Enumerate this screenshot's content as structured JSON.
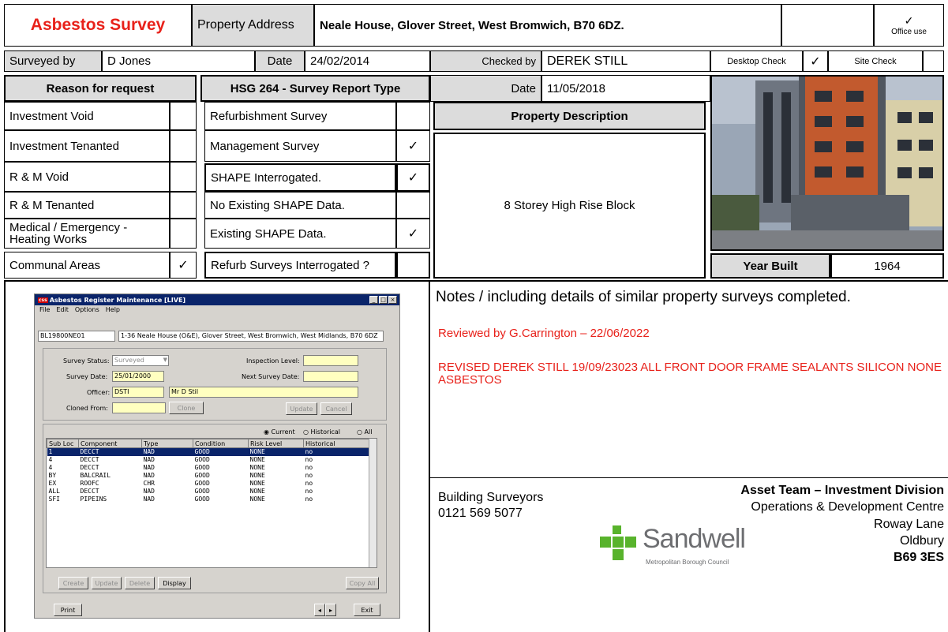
{
  "header": {
    "title": "Asbestos Survey",
    "address_label": "Property Address",
    "address_value": "Neale House, Glover Street, West Bromwich, B70 6DZ.",
    "office_tick": "✓",
    "office_label": "Office use"
  },
  "surveyed": {
    "label": "Surveyed by",
    "value": "D Jones",
    "date_label": "Date",
    "date_value": "24/02/2014"
  },
  "checked": {
    "label": "Checked by",
    "value": "DEREK STILL",
    "desktop_label": "Desktop Check",
    "desktop_tick": "✓",
    "site_label": "Site Check",
    "site_tick": "",
    "date_label": "Date",
    "date_value": "11/05/2018"
  },
  "reason": {
    "heading": "Reason for request",
    "items": [
      {
        "label": "Investment Void",
        "tick": ""
      },
      {
        "label": "Investment Tenanted",
        "tick": ""
      },
      {
        "label": "R & M Void",
        "tick": ""
      },
      {
        "label": "R & M Tenanted",
        "tick": ""
      },
      {
        "label": "Medical / Emergency - Heating Works",
        "tick": ""
      },
      {
        "label": "Communal Areas",
        "tick": "✓"
      }
    ]
  },
  "hsg": {
    "heading": "HSG 264 - Survey Report Type",
    "items": [
      {
        "label": "Refurbishment Survey",
        "tick": ""
      },
      {
        "label": "Management Survey",
        "tick": "✓"
      },
      {
        "label": "SHAPE Interrogated.",
        "tick": "✓"
      },
      {
        "label": "No Existing SHAPE Data.",
        "tick": ""
      },
      {
        "label": "Existing SHAPE Data.",
        "tick": "✓"
      },
      {
        "label": "Refurb Surveys Interrogated ?",
        "tick": ""
      }
    ]
  },
  "property": {
    "heading": "Property Description",
    "description": "8 Storey High Rise Block",
    "year_label": "Year Built",
    "year_value": "1964"
  },
  "notes": {
    "heading": "Notes / including details of similar property surveys completed.",
    "reviewed": "Reviewed by G.Carrington – 22/06/2022",
    "revised": "REVISED DEREK STILL 19/09/23023 ALL FRONT DOOR FRAME SEALANTS SILICON NONE ASBESTOS"
  },
  "contact": {
    "dept": "Building Surveyors",
    "phone": "0121 569 5077",
    "team": "Asset Team – Investment Division",
    "addr1": "Operations & Development Centre",
    "addr2": "Roway Lane",
    "addr3": "Oldbury",
    "postcode": "B69 3ES",
    "logo_name": "Sandwell",
    "logo_sub": "Metropolitan Borough Council",
    "logo_color": "#58b32c"
  },
  "window": {
    "title": "Asbestos Register Maintenance [LIVE]",
    "menu": [
      "File",
      "Edit",
      "Options",
      "Help"
    ],
    "code": "BL19800NE01",
    "address": "1-36 Neale House (O&E), Glover Street, West Bromwich, West Midlands, B70 6DZ",
    "status_label": "Survey Status:",
    "status_value": "Surveyed",
    "date_label": "Survey Date:",
    "date_value": "25/01/2000",
    "officer_label": "Officer:",
    "officer_code": "DSTI",
    "officer_name": "Mr D Stil",
    "cloned_label": "Cloned From:",
    "cloned_value": "",
    "clone_btn": "Clone",
    "insp_label": "Inspection Level:",
    "insp_value": "",
    "next_label": "Next Survey Date:",
    "next_value": "",
    "update_btn": "Update",
    "cancel_btn": "Cancel",
    "radio_current": "Current",
    "radio_historical": "Historical",
    "radio_all": "All",
    "columns": [
      "Sub Loc",
      "Component",
      "Type",
      "Condition",
      "Risk Level",
      "Historical"
    ],
    "rows": [
      [
        "1",
        "DECCT",
        "NAD",
        "GOOD",
        "NONE",
        "no"
      ],
      [
        "4",
        "DECCT",
        "NAD",
        "GOOD",
        "NONE",
        "no"
      ],
      [
        "4",
        "DECCT",
        "NAD",
        "GOOD",
        "NONE",
        "no"
      ],
      [
        "BY",
        "BALCRAIL",
        "NAD",
        "GOOD",
        "NONE",
        "no"
      ],
      [
        "EX",
        "ROOFC",
        "CHR",
        "GOOD",
        "NONE",
        "no"
      ],
      [
        "ALL",
        "DECCT",
        "NAD",
        "GOOD",
        "NONE",
        "no"
      ],
      [
        "SFI",
        "PIPEINS",
        "NAD",
        "GOOD",
        "NONE",
        "no"
      ]
    ],
    "create_btn": "Create",
    "update2_btn": "Update",
    "delete_btn": "Delete",
    "display_btn": "Display",
    "copyall_btn": "Copy All",
    "print_btn": "Print",
    "exit_btn": "Exit"
  }
}
